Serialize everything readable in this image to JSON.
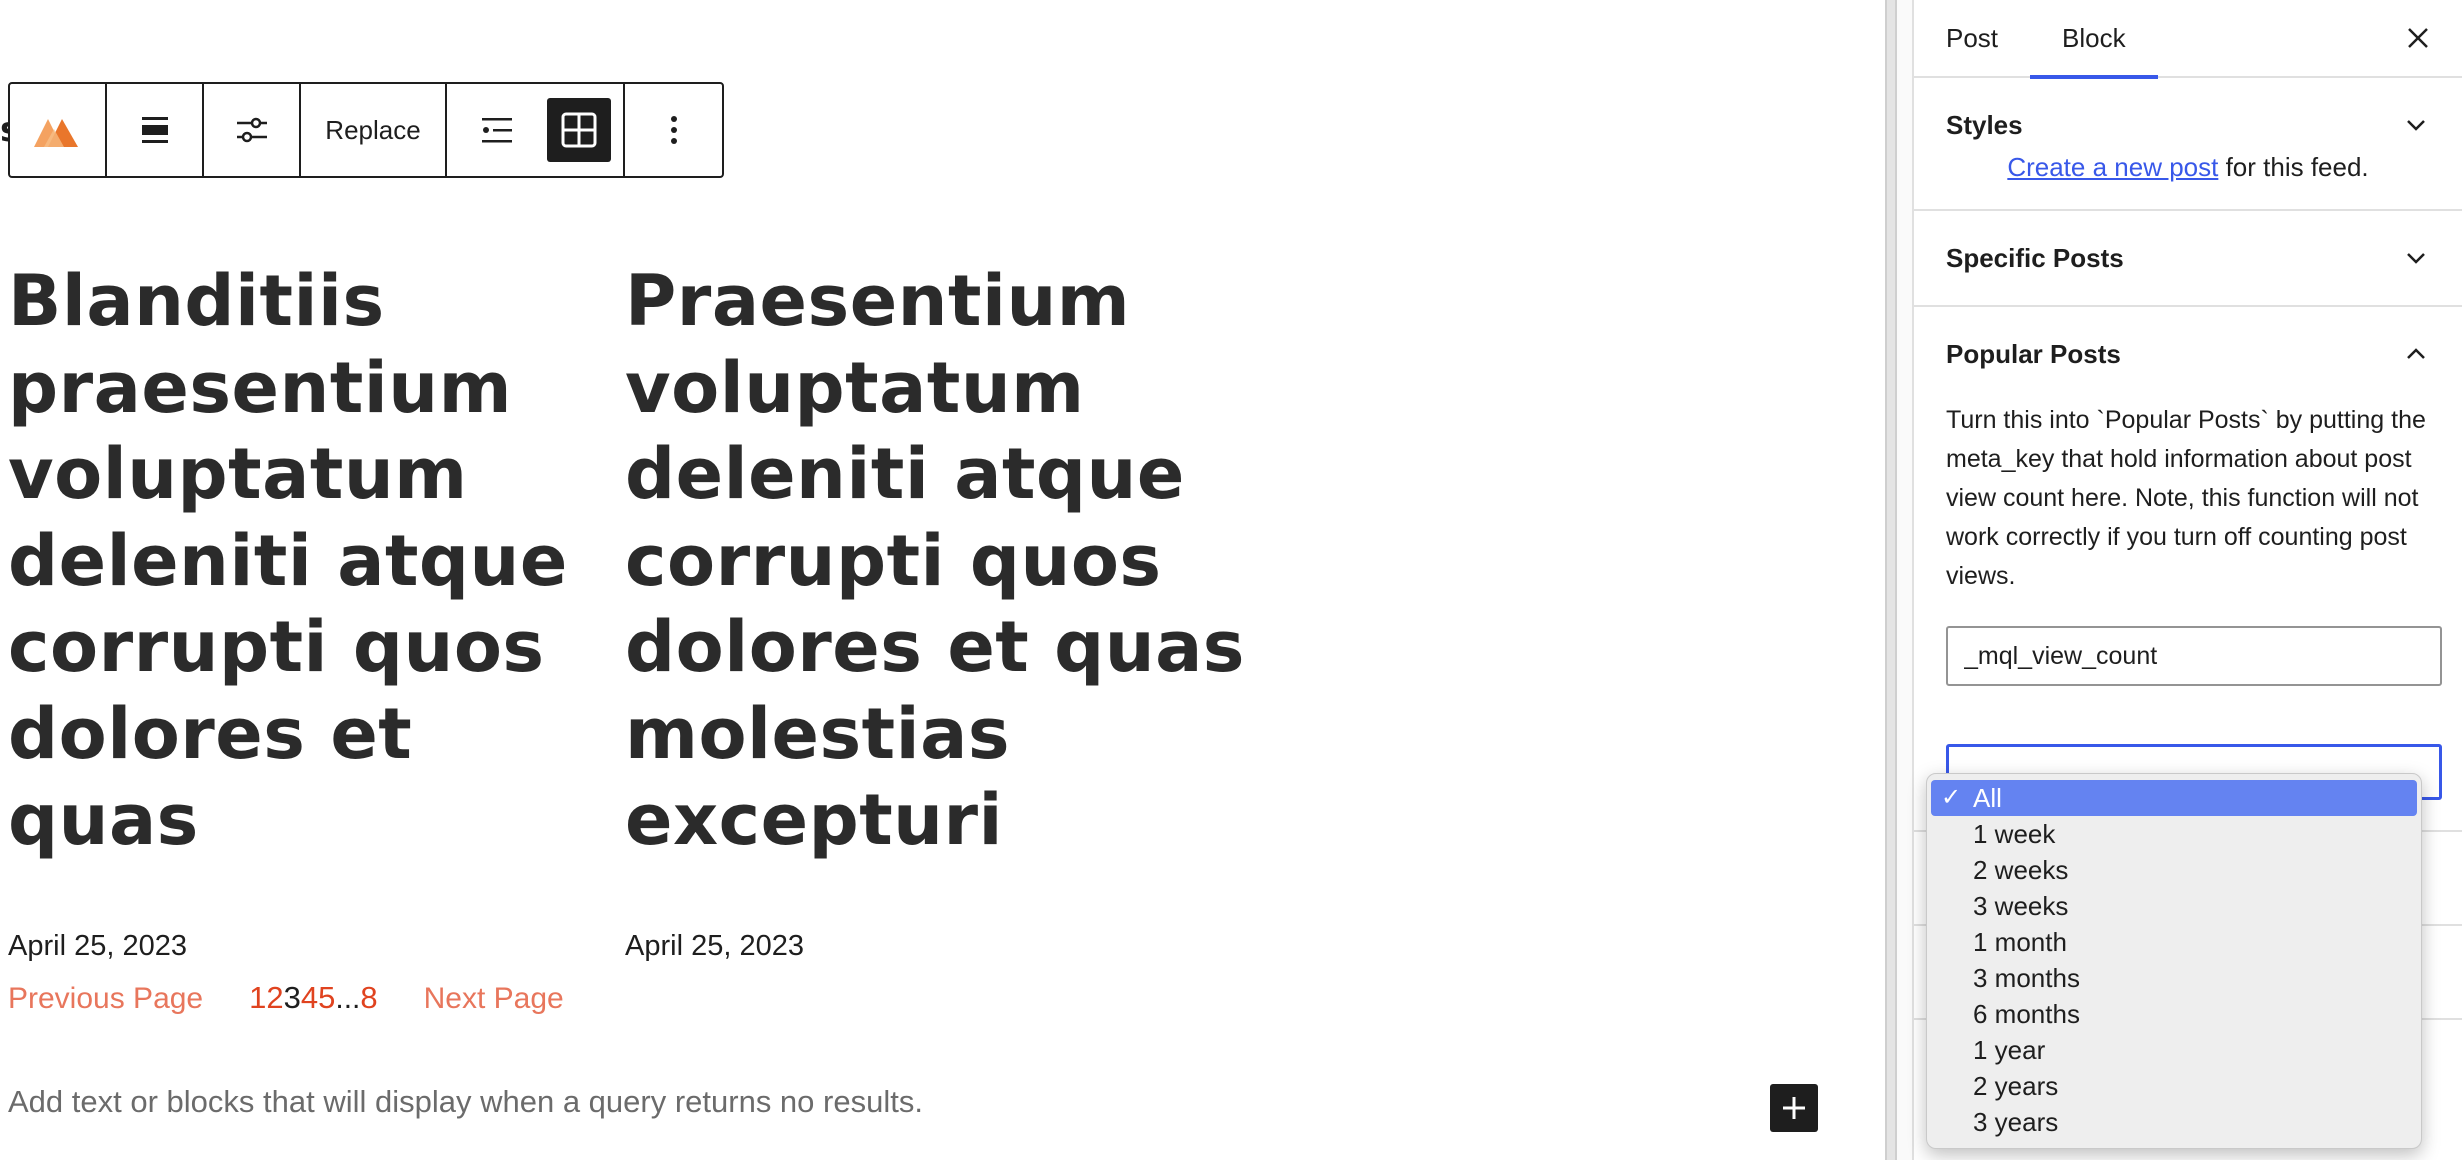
{
  "toolbar": {
    "replace_label": "Replace",
    "items": [
      "block-logo-icon",
      "align-icon",
      "settings-sliders-icon",
      "list-view-icon",
      "grid-view-icon",
      "more-options-icon"
    ]
  },
  "canvas": {
    "partial_glyph": "s",
    "posts": [
      {
        "title": "Blanditiis praesentium voluptatum deleniti atque corrupti quos dolores et quas",
        "date": "April 25, 2023"
      },
      {
        "title": "Praesentium voluptatum deleniti atque corrupti quos dolores et quas molestias excepturi",
        "date": "April 25, 2023"
      }
    ],
    "pagination": {
      "previous": "Previous Page",
      "pages": [
        "1",
        "2",
        "3",
        "4",
        "5"
      ],
      "current": "3",
      "ellipsis": "...",
      "last": "8",
      "next": "Next Page"
    },
    "no_results": "Add text or blocks that will display when a query returns no results."
  },
  "sidebar": {
    "tabs": [
      "Post",
      "Block"
    ],
    "active_tab": "Block",
    "panels": {
      "styles": {
        "title": "Styles",
        "link": "Create a new post",
        "text": " for this feed."
      },
      "specific": {
        "title": "Specific Posts"
      },
      "popular": {
        "title": "Popular Posts",
        "help": "Turn this into `Popular Posts` by putting the meta_key that hold information about post view count here. Note, this function will not work correctly if you turn off counting post views.",
        "meta_value": "_mql_view_count"
      }
    }
  },
  "dropdown": {
    "selected": "All",
    "options": [
      "All",
      "1 week",
      "2 weeks",
      "3 weeks",
      "1 month",
      "3 months",
      "6 months",
      "1 year",
      "2 years",
      "3 years"
    ]
  },
  "colors": {
    "accent": "#3858e9",
    "pagination_link": "#e0431f",
    "prev_next": "#e8765c",
    "dark": "#1e1e1e",
    "dropdown_highlight": "#6483f1"
  }
}
